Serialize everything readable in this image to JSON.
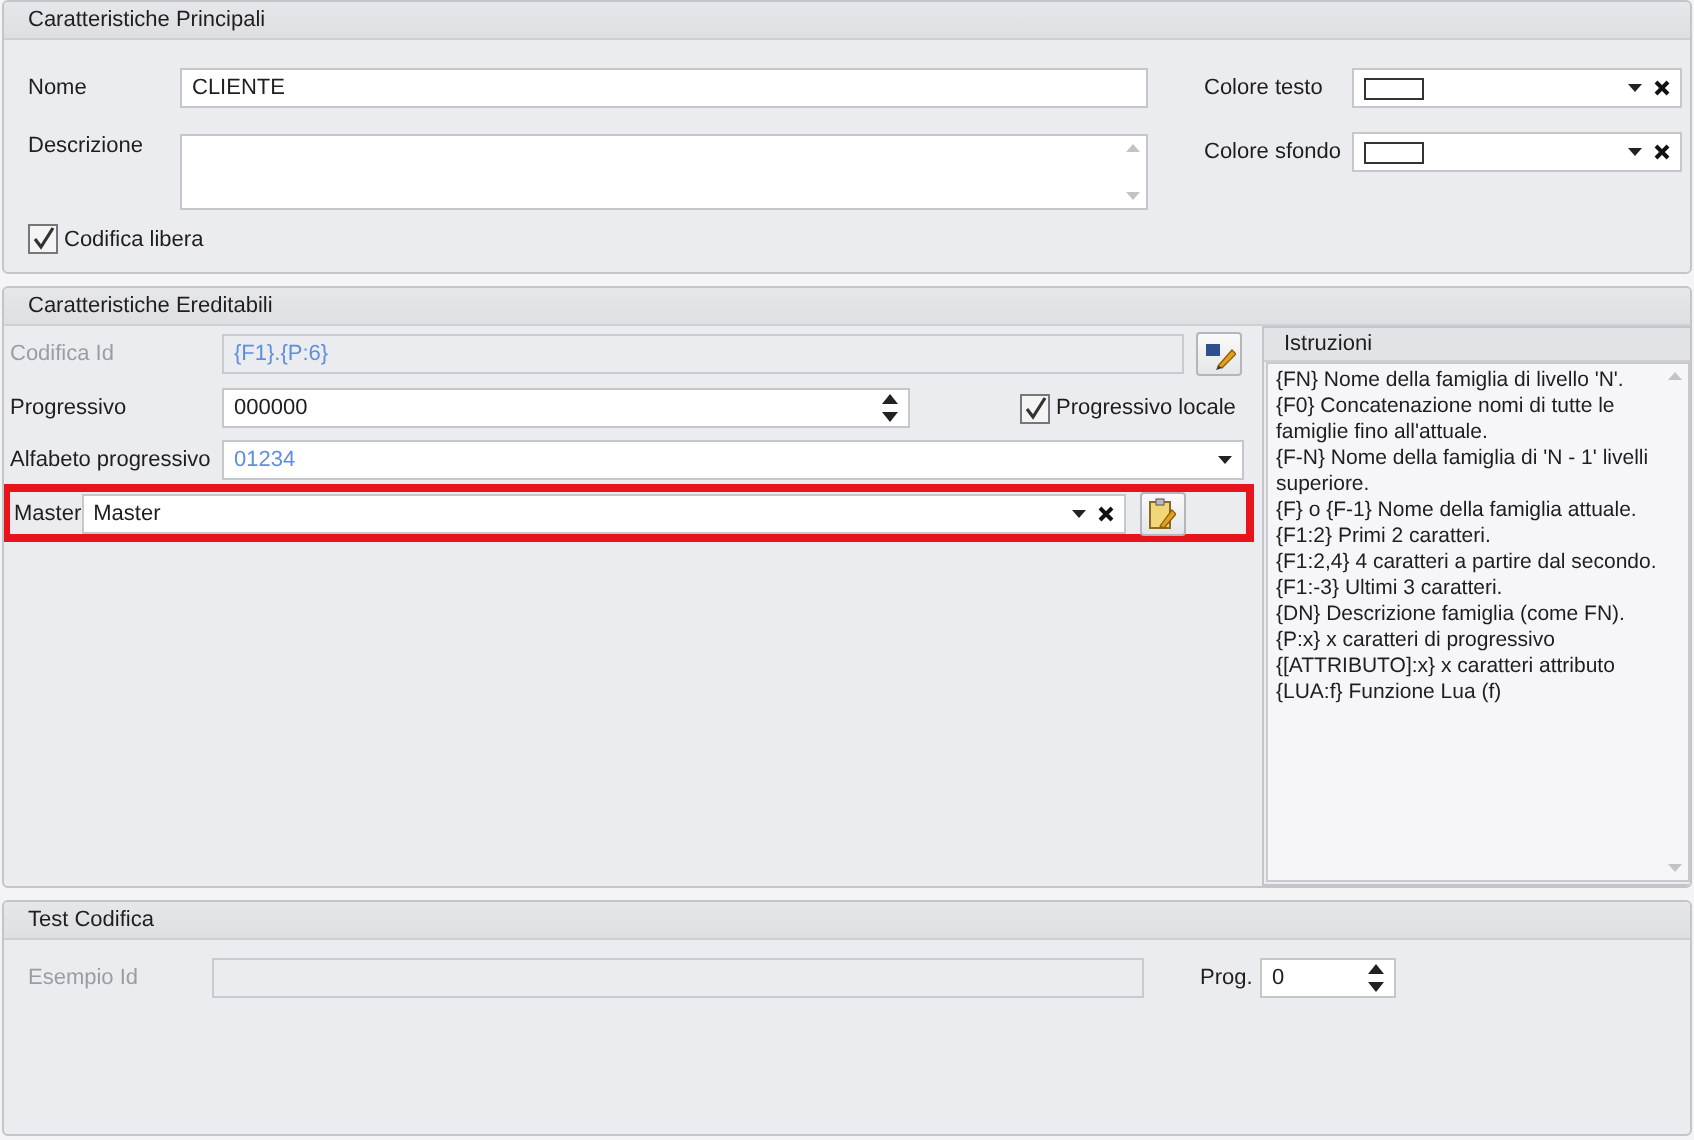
{
  "main": {
    "title": "Caratteristiche Principali",
    "name": {
      "label": "Nome",
      "value": "CLIENTE"
    },
    "description": {
      "label": "Descrizione"
    },
    "text_color": {
      "label": "Colore testo"
    },
    "background_color": {
      "label": "Colore sfondo"
    },
    "free_coding": {
      "label": "Codifica libera",
      "checked": true
    }
  },
  "inheritable": {
    "title": "Caratteristiche Ereditabili",
    "id_coding": {
      "label": "Codifica Id",
      "value": "{F1}.{P:6}",
      "disabled": true
    },
    "progressive": {
      "label": "Progressivo",
      "value": "000000"
    },
    "local_progressive": {
      "label": "Progressivo locale",
      "checked": true
    },
    "alphabet": {
      "label": "Alfabeto progressivo",
      "value": "01234"
    },
    "master": {
      "label": "Master",
      "value": "Master",
      "highlighted": true
    },
    "instructions": {
      "title": "Istruzioni",
      "lines": [
        "{FN} Nome della famiglia di livello 'N'.",
        "{F0} Concatenazione nomi di tutte le famiglie fino all'attuale.",
        "{F-N} Nome della famiglia di 'N - 1' livelli superiore.",
        "{F} o {F-1} Nome della famiglia attuale.",
        "{F1:2} Primi 2 caratteri.",
        "{F1:2,4} 4 caratteri a partire dal secondo.",
        "{F1:-3} Ultimi 3 caratteri.",
        "{DN} Descrizione famiglia (come FN).",
        "{P:x} x caratteri di progressivo",
        "{[ATTRIBUTO]:x} x caratteri attributo",
        "{LUA:f} Funzione Lua (f)"
      ]
    }
  },
  "test": {
    "title": "Test Codifica",
    "example_id": {
      "label": "Esempio Id",
      "disabled": true
    },
    "prog": {
      "label": "Prog.",
      "value": "0"
    }
  }
}
